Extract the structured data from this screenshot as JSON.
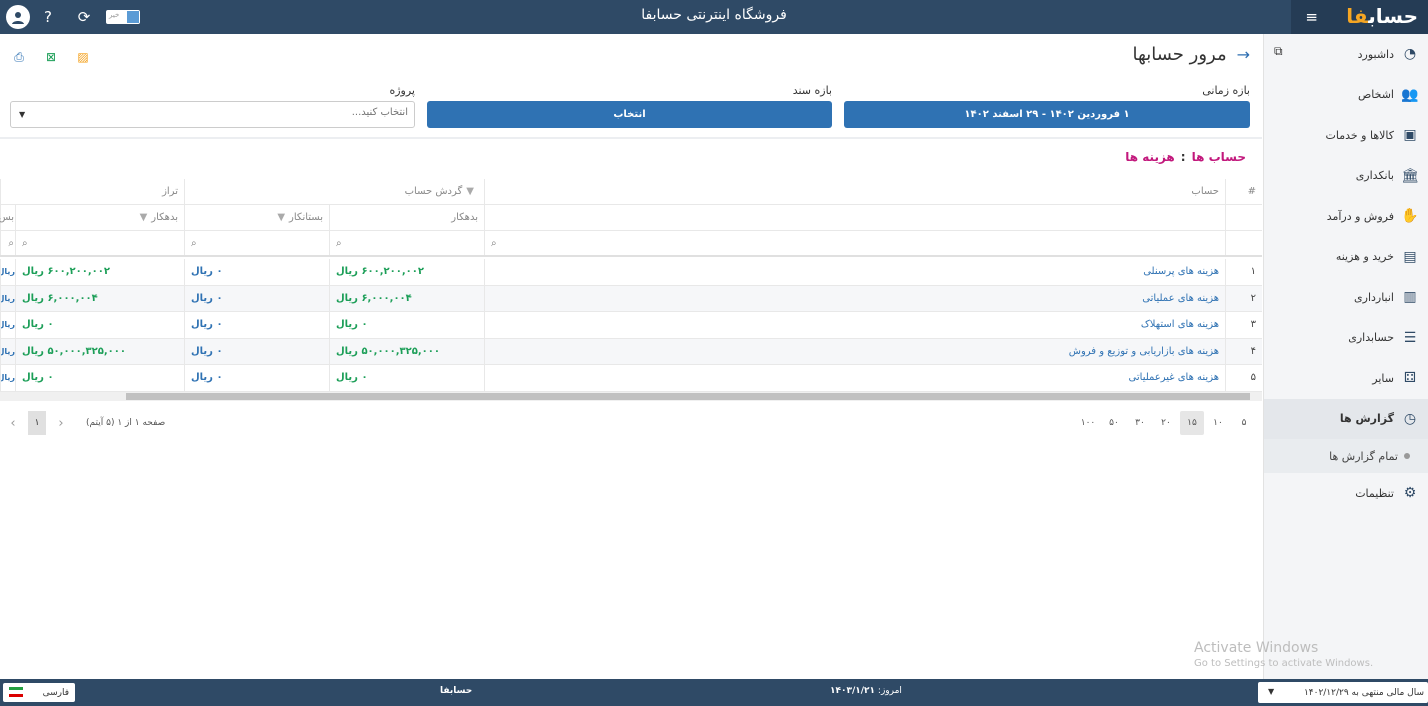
{
  "topbar": {
    "site_title": "فروشگاه اینترنتی حسابفا",
    "logo_main": "حساب",
    "logo_accent": "فا",
    "toggle_text": "خیر"
  },
  "sidebar": {
    "items": [
      {
        "label": "داشبورد",
        "icon": "dashboard-icon"
      },
      {
        "label": "اشخاص",
        "icon": "people-icon"
      },
      {
        "label": "کالاها و خدمات",
        "icon": "box-icon"
      },
      {
        "label": "بانکداری",
        "icon": "bank-icon"
      },
      {
        "label": "فروش و درآمد",
        "icon": "sales-icon"
      },
      {
        "label": "خرید و هزینه",
        "icon": "wallet-icon"
      },
      {
        "label": "انبارداری",
        "icon": "warehouse-icon"
      },
      {
        "label": "حسابداری",
        "icon": "ledger-icon"
      },
      {
        "label": "سایر",
        "icon": "other-icon"
      },
      {
        "label": "گزارش ها",
        "icon": "reports-icon"
      },
      {
        "label": "تنظیمات",
        "icon": "settings-icon"
      }
    ],
    "sub_item": "تمام گزارش ها"
  },
  "page": {
    "title": "مرور حسابها",
    "date_range_label": "بازه زمانی",
    "date_range_value": "۱ فروردین ۱۴۰۲ - ۲۹ اسفند ۱۴۰۲",
    "doc_range_label": "بازه سند",
    "doc_range_button": "انتخاب",
    "project_label": "پروژه",
    "project_placeholder": "انتخاب کنید...",
    "breadcrumb_root": "حساب ها",
    "breadcrumb_sep": ":",
    "breadcrumb_current": "هزینه ها"
  },
  "grid": {
    "headers": {
      "num": "#",
      "account": "حساب",
      "turnover_group": "گردش حساب",
      "balance_group": "تراز",
      "debit": "بدهکار",
      "credit": "بستانکار",
      "balance_debit": "بدهکار",
      "balance_cut": "بس"
    },
    "rows": [
      {
        "num": "۱",
        "account": "هزینه های پرسنلی",
        "debit": "۶۰۰,۲۰۰,۰۰۲ ریال",
        "credit": "۰ ریال",
        "balance": "۶۰۰,۲۰۰,۰۰۲ ریال",
        "cut": "ریال"
      },
      {
        "num": "۲",
        "account": "هزینه های عملیاتی",
        "debit": "۶,۰۰۰,۰۰۴ ریال",
        "credit": "۰ ریال",
        "balance": "۶,۰۰۰,۰۰۴ ریال",
        "cut": "ریال"
      },
      {
        "num": "۳",
        "account": "هزینه های استهلاک",
        "debit": "۰ ریال",
        "credit": "۰ ریال",
        "balance": "۰ ریال",
        "cut": "ریال"
      },
      {
        "num": "۴",
        "account": "هزینه های بازاریابی و توزیع و فروش",
        "debit": "۵۰,۰۰۰,۳۲۵,۰۰۰ ریال",
        "credit": "۰ ریال",
        "balance": "۵۰,۰۰۰,۳۲۵,۰۰۰ ریال",
        "cut": "ریال"
      },
      {
        "num": "۵",
        "account": "هزینه های غیرعملیاتی",
        "debit": "۰ ریال",
        "credit": "۰ ریال",
        "balance": "۰ ریال",
        "cut": "ریال"
      }
    ]
  },
  "pager": {
    "sizes": [
      "۵",
      "۱۰",
      "۱۵",
      "۲۰",
      "۳۰",
      "۵۰",
      "۱۰۰"
    ],
    "selected_size": "۱۵",
    "current_page": "۱",
    "info": "صفحه ۱ از ۱ (۵ آیتم)"
  },
  "watermark": {
    "line1": "Activate Windows",
    "line2": "Go to Settings to activate Windows."
  },
  "footer": {
    "fiscal_year": "سال مالی منتهی به ۱۴۰۲/۱۲/۲۹",
    "today_label": "امروز:",
    "today_value": "۱۴۰۳/۱/۲۱",
    "brand": "حسابفا",
    "language": "فارسی"
  },
  "colors": {
    "topbar": "#2f4a66",
    "primary_button": "#2f72b3",
    "breadcrumb": "#c2187c",
    "positive_value": "#1b9e57",
    "neutral_value": "#2f72b3"
  }
}
